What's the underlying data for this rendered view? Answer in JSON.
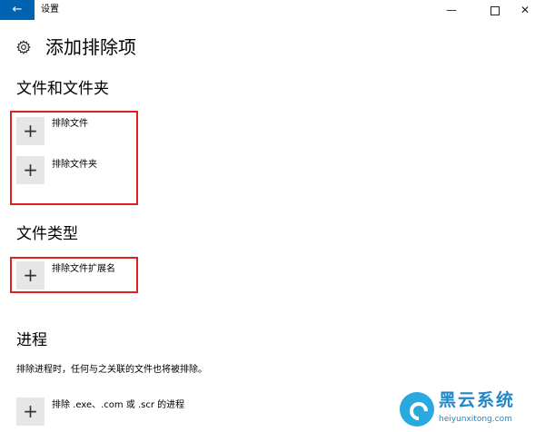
{
  "titlebar": {
    "back_icon": "←",
    "app_name": "设置",
    "minimize_icon": "—",
    "close_icon": "✕"
  },
  "header": {
    "title": "添加排除项",
    "icon": "gear-icon"
  },
  "sections": {
    "files": {
      "title": "文件和文件夹",
      "items": [
        {
          "icon": "+",
          "label": "排除文件"
        },
        {
          "icon": "+",
          "label": "排除文件夹"
        }
      ]
    },
    "types": {
      "title": "文件类型",
      "items": [
        {
          "icon": "+",
          "label": "排除文件扩展名"
        }
      ]
    },
    "process": {
      "title": "进程",
      "description": "排除进程时，任何与之关联的文件也将被排除。",
      "items": [
        {
          "icon": "+",
          "label": "排除 .exe、.com 或 .scr 的进程"
        }
      ]
    }
  },
  "watermark": {
    "name": "黑云系统",
    "url": "heiyunxitong.com"
  },
  "colors": {
    "accent": "#0063b1",
    "highlight_box": "#e02020",
    "tile": "#e6e6e6",
    "watermark": "#1f88c9"
  }
}
